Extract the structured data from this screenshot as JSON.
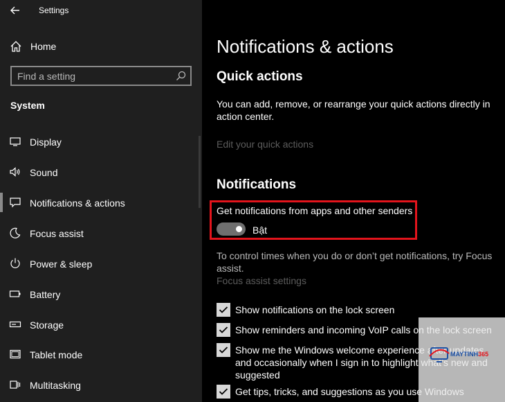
{
  "sidebar": {
    "app_title": "Settings",
    "home_label": "Home",
    "search_placeholder": "Find a setting",
    "section_label": "System",
    "items": [
      {
        "label": "Display",
        "icon": "monitor-icon"
      },
      {
        "label": "Sound",
        "icon": "speaker-icon"
      },
      {
        "label": "Notifications & actions",
        "icon": "notification-icon",
        "active": true
      },
      {
        "label": "Focus assist",
        "icon": "moon-icon"
      },
      {
        "label": "Power & sleep",
        "icon": "power-icon"
      },
      {
        "label": "Battery",
        "icon": "battery-icon"
      },
      {
        "label": "Storage",
        "icon": "storage-icon"
      },
      {
        "label": "Tablet mode",
        "icon": "tablet-icon"
      },
      {
        "label": "Multitasking",
        "icon": "multitasking-icon"
      }
    ]
  },
  "main": {
    "title": "Notifications & actions",
    "quick_actions": {
      "heading": "Quick actions",
      "description": "You can add, remove, or rearrange your quick actions directly in action center.",
      "edit_link": "Edit your quick actions"
    },
    "notifications": {
      "heading": "Notifications",
      "toggle_label": "Get notifications from apps and other senders",
      "toggle_state": "Bật",
      "toggle_on": true,
      "focus_text": "To control times when you do or don’t get notifications, try Focus assist.",
      "focus_link": "Focus assist settings",
      "checkboxes": [
        {
          "label": "Show notifications on the lock screen",
          "checked": true
        },
        {
          "label": "Show reminders and incoming VoIP calls on the lock screen",
          "checked": true
        },
        {
          "label": "Show me the Windows welcome experience after updates and occasionally when I sign in to highlight what’s new and suggested",
          "checked": true
        },
        {
          "label": "Get tips, tricks, and suggestions as you use Windows",
          "checked": true
        }
      ]
    }
  },
  "watermark": {
    "brand_main": "MAYTINH",
    "brand_num": "365"
  },
  "colors": {
    "sidebar_bg": "#1f1f1f",
    "main_bg": "#000000",
    "highlight_border": "#e3141c",
    "toggle_on": "#6f6f6f",
    "disabled_text": "#5c5c5c"
  }
}
